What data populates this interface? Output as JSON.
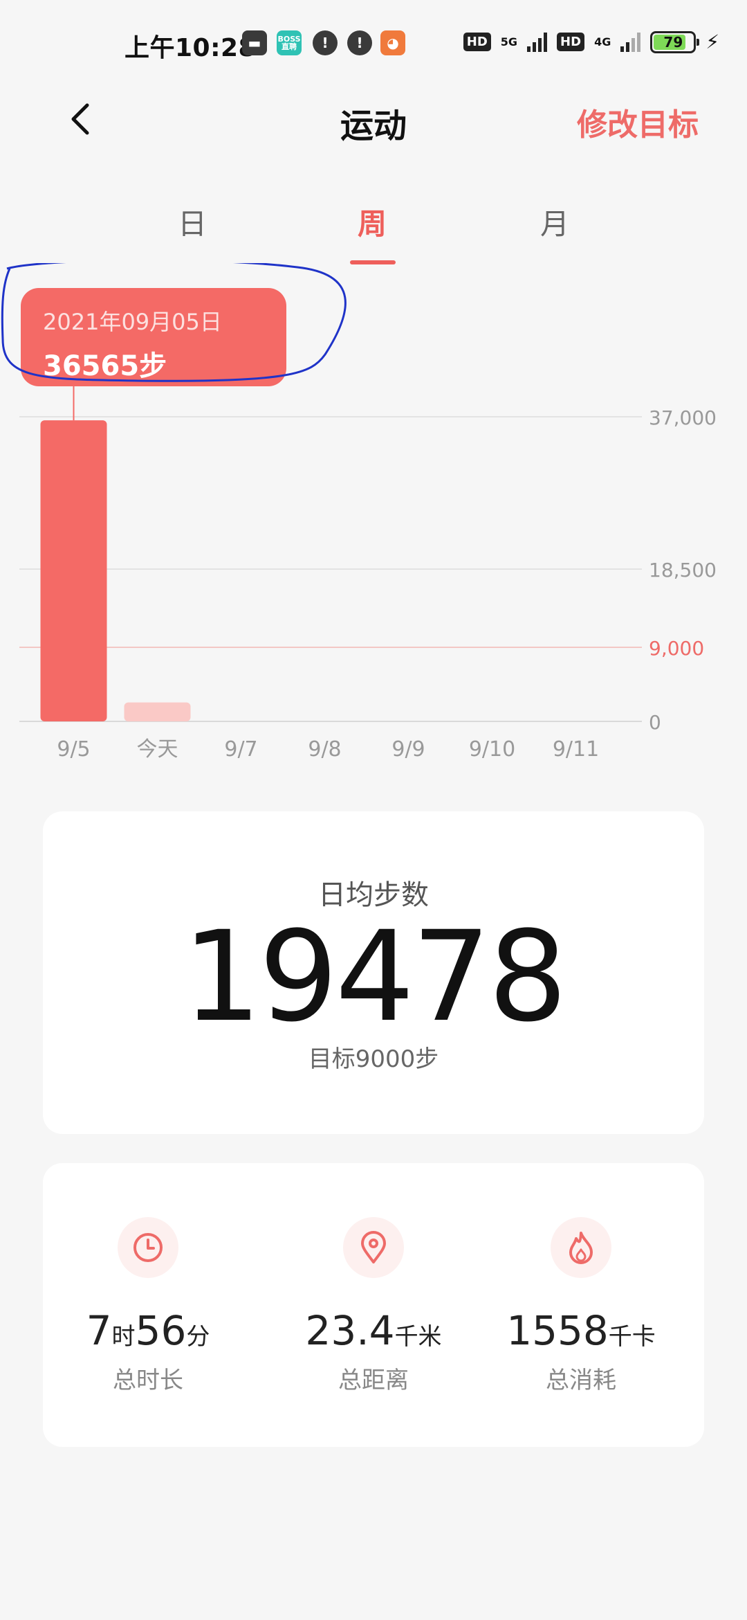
{
  "status_bar": {
    "time": "上午10:28",
    "boss_label": "BOSS直聘",
    "hd1": "HD",
    "net1": "5G",
    "hd2": "HD",
    "net2": "4G",
    "battery": "79"
  },
  "header": {
    "title": "运动",
    "action": "修改目标"
  },
  "tabs": [
    {
      "label": "日",
      "active": false
    },
    {
      "label": "周",
      "active": true
    },
    {
      "label": "月",
      "active": false
    }
  ],
  "tooltip": {
    "date": "2021年09月05日",
    "steps": "36565步"
  },
  "chart_data": {
    "type": "bar",
    "categories": [
      "9/5",
      "今天",
      "9/7",
      "9/8",
      "9/9",
      "9/10",
      "9/11"
    ],
    "values": [
      36565,
      2300,
      0,
      0,
      0,
      0,
      0
    ],
    "ylim": [
      0,
      37000
    ],
    "yticks": [
      "37,000",
      "18,500",
      "0"
    ],
    "ytick_values": [
      37000,
      18500,
      0
    ],
    "goal": {
      "value": 9000,
      "label": "9,000"
    },
    "bar_color": "#f46a66",
    "today_color": "#fac9c6",
    "goal_color": "#ee6b68",
    "selected_index": 0
  },
  "daily_average": {
    "label": "日均步数",
    "value": "19478",
    "goal": "目标9000步"
  },
  "stats": [
    {
      "icon": "clock-icon",
      "value_parts": [
        "7",
        "时",
        "56",
        "分"
      ],
      "label": "总时长"
    },
    {
      "icon": "location-pin-icon",
      "value": "23.4",
      "unit": "千米",
      "label": "总距离"
    },
    {
      "icon": "flame-icon",
      "value": "1558",
      "unit": "千卡",
      "label": "总消耗"
    }
  ],
  "colors": {
    "accent": "#ee5f5b",
    "background": "#f6f6f6",
    "card": "#ffffff"
  }
}
